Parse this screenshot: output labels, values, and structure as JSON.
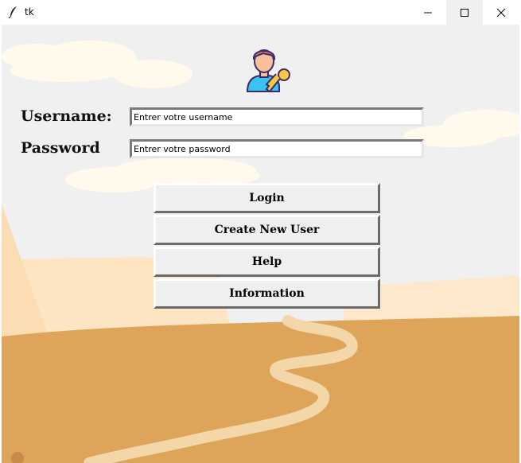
{
  "window": {
    "title": "tk"
  },
  "colors": {
    "sky": "#f0f0f0",
    "cloud": "#fffaeb",
    "sand": "#dea55a",
    "path": "#f3d7a8",
    "dune": "#fde5c4"
  },
  "form": {
    "username_label": "Username:",
    "password_label": "Password",
    "username_value": "Entrer votre username",
    "password_value": "Entrer votre password"
  },
  "buttons": {
    "login": "Login",
    "create_user": "Create New User",
    "help": "Help",
    "information": "Information"
  },
  "icons": {
    "app": "feather-icon",
    "logo": "user-key-icon",
    "minimize": "minimize-icon",
    "maximize": "maximize-icon",
    "close": "close-icon"
  }
}
